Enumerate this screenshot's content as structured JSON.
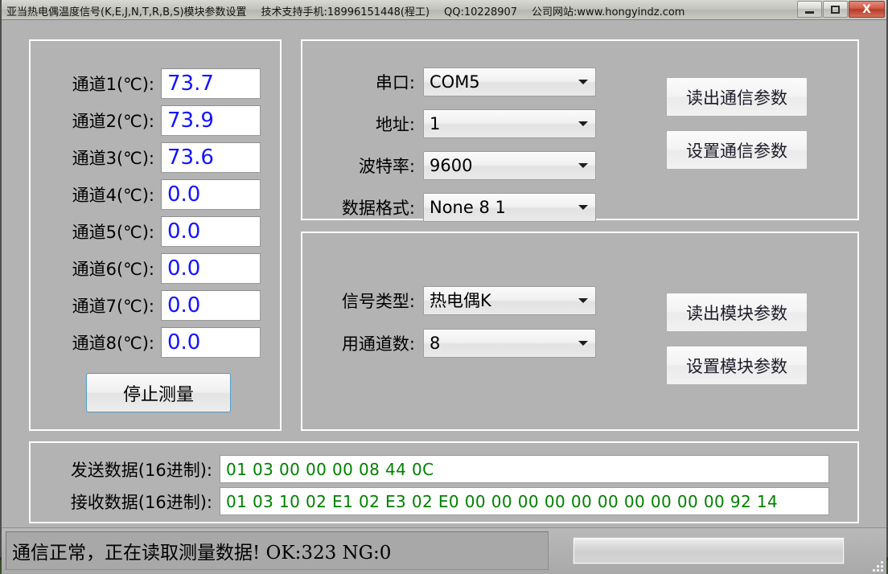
{
  "window": {
    "title_main": "亚当热电偶温度信号(K,E,J,N,T,R,B,S)模块参数设置",
    "title_support": "技术支持手机:18996151448(程工)",
    "title_qq": "QQ:10228907",
    "title_site": "公司网站:www.hongyindz.com",
    "minimize_label": "—",
    "maximize_label": "",
    "close_label": "X"
  },
  "channels": {
    "items": [
      {
        "label": "通道1(℃):",
        "value": "73.7"
      },
      {
        "label": "通道2(℃):",
        "value": "73.9"
      },
      {
        "label": "通道3(℃):",
        "value": "73.6"
      },
      {
        "label": "通道4(℃):",
        "value": "0.0"
      },
      {
        "label": "通道5(℃):",
        "value": "0.0"
      },
      {
        "label": "通道6(℃):",
        "value": "0.0"
      },
      {
        "label": "通道7(℃):",
        "value": "0.0"
      },
      {
        "label": "通道8(℃):",
        "value": "0.0"
      }
    ],
    "stop_button": "停止测量",
    "value_color": "#1414ff"
  },
  "comm": {
    "fields": [
      {
        "label": "串口:",
        "value": "COM5"
      },
      {
        "label": "地址:",
        "value": "1"
      },
      {
        "label": "波特率:",
        "value": "9600"
      },
      {
        "label": "数据格式:",
        "value": "None 8 1"
      }
    ],
    "read_button": "读出通信参数",
    "set_button": "设置通信参数"
  },
  "module": {
    "fields": [
      {
        "label": "信号类型:",
        "value": "热电偶K"
      },
      {
        "label": "用通道数:",
        "value": "8"
      }
    ],
    "read_button": "读出模块参数",
    "set_button": "设置模块参数"
  },
  "data": {
    "send_label": "发送数据(16进制):",
    "send_value": "01 03 00 00 00 08 44 0C",
    "recv_label": "接收数据(16进制):",
    "recv_value": "01 03 10 02 E1 02 E3 02 E0 00 00 00 00 00 00 00 00 00 00 92 14",
    "hex_color": "#008000"
  },
  "status": {
    "message": "通信正常，正在读取测量数据!  OK:323  NG:0",
    "progress_percent": 0
  }
}
